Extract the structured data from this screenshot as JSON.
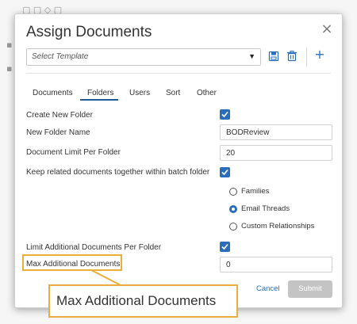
{
  "dialog": {
    "title": "Assign Documents",
    "close_glyph": "×",
    "template_placeholder": "Select Template",
    "template_caret": "▼",
    "add_glyph": "+"
  },
  "tabs": [
    {
      "label": "Documents",
      "active": false
    },
    {
      "label": "Folders",
      "active": true
    },
    {
      "label": "Users",
      "active": false
    },
    {
      "label": "Sort",
      "active": false
    },
    {
      "label": "Other",
      "active": false
    }
  ],
  "form": {
    "create_new_folder_label": "Create New Folder",
    "create_new_folder_checked": true,
    "new_folder_name_label": "New Folder Name",
    "new_folder_name_value": "BODReview",
    "doc_limit_label": "Document Limit Per Folder",
    "doc_limit_value": "20",
    "keep_related_label": "Keep related documents together within batch folder",
    "keep_related_checked": true,
    "radio_options": [
      {
        "label": "Families",
        "selected": false
      },
      {
        "label": "Email Threads",
        "selected": true
      },
      {
        "label": "Custom Relationships",
        "selected": false
      }
    ],
    "limit_additional_label": "Limit Additional Documents Per Folder",
    "limit_additional_checked": true,
    "max_additional_label": "Max Additional Documents",
    "max_additional_value": "0"
  },
  "footer": {
    "cancel_label": "Cancel",
    "submit_label": "Submit"
  },
  "callout": {
    "text": "Max Additional Documents"
  },
  "colors": {
    "accent": "#2a6ebb",
    "highlight": "#e8b03a",
    "disabled_button": "#c4c4c4"
  },
  "icons": {
    "save": "save-icon",
    "delete": "trash-icon",
    "add": "plus-icon",
    "close": "close-icon",
    "check": "check-icon"
  }
}
